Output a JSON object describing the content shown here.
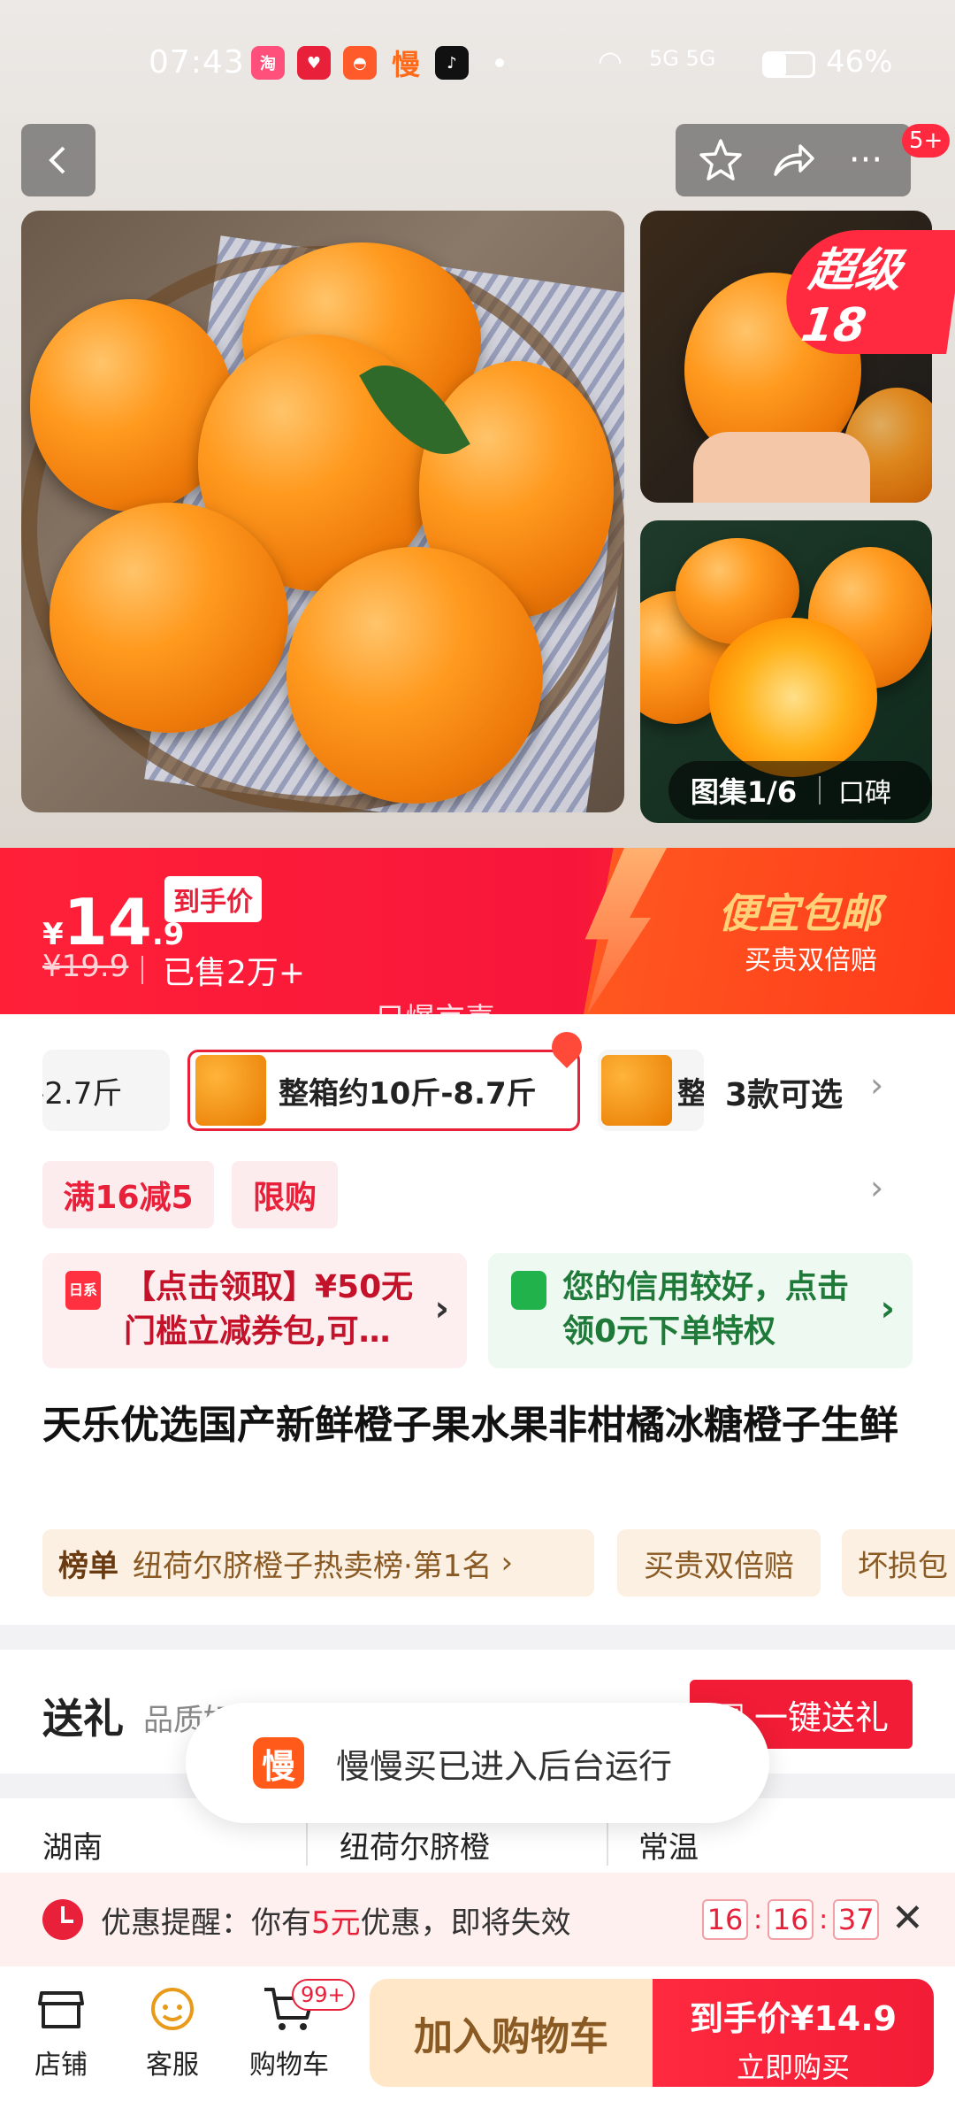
{
  "status_bar": {
    "time": "07:43",
    "network": "5G 5G",
    "battery": "46%",
    "app_icons": [
      "taobao-icon",
      "heart-app-icon",
      "shop-app-icon",
      "manman-icon",
      "tiktok-icon"
    ]
  },
  "header": {
    "badge_count": "5+",
    "super_badge": "超级18",
    "gallery_label": "图集1/6",
    "review_label": "口碑"
  },
  "price": {
    "currency": "¥",
    "main": "14",
    "decimal": ".9",
    "after_label": "到手价",
    "original": "¥19.9",
    "sold": "已售2万+",
    "promo_title": "便宜包邮",
    "promo_sub": "买贵双倍赔",
    "watermark": "只爆京喜"
  },
  "variants": {
    "items": [
      {
        "label": "-2.7斤"
      },
      {
        "label": "整箱约10斤-8.7斤"
      },
      {
        "label": "整"
      }
    ],
    "count_label": "3款可选"
  },
  "tags": [
    "满16减5",
    "限购"
  ],
  "coupons": {
    "left_text": "【点击领取】¥50无门槛立减券包,可…",
    "right_text": "您的信用较好，点击领0元下单特权"
  },
  "title": "天乐优选国产新鲜橙子果水果非柑橘冰糖橙子生鲜",
  "chips": {
    "rank_label": "榜单",
    "rank_text": "纽荷尔脐橙子热卖榜·第1名",
    "guarantee": "买贵双倍赔",
    "damage": "坏损包"
  },
  "gift": {
    "title": "送礼",
    "subtitle": "品质好礼 定制贺卡",
    "button": "一键送礼"
  },
  "attributes": [
    "湖南",
    "纽荷尔脐橙",
    "常温"
  ],
  "toast": {
    "text": "慢慢买已进入后台运行",
    "icon_char": "慢"
  },
  "reminder": {
    "prefix": "优惠提醒：你有",
    "amount": "5元",
    "suffix": "优惠，即将失效",
    "hours": "16",
    "minutes": "16",
    "seconds": "37"
  },
  "bottom_bar": {
    "shop": "店铺",
    "service": "客服",
    "cart": "购物车",
    "cart_badge": "99+",
    "add_to_cart": "加入购物车",
    "buy_price_label": "到手价¥14.9",
    "buy_now": "立即购买"
  },
  "colors": {
    "accent": "#f21c36",
    "promo_gold": "#ffd27a",
    "coupon_green": "#22b24c",
    "chip_brown": "#8a5a24"
  }
}
